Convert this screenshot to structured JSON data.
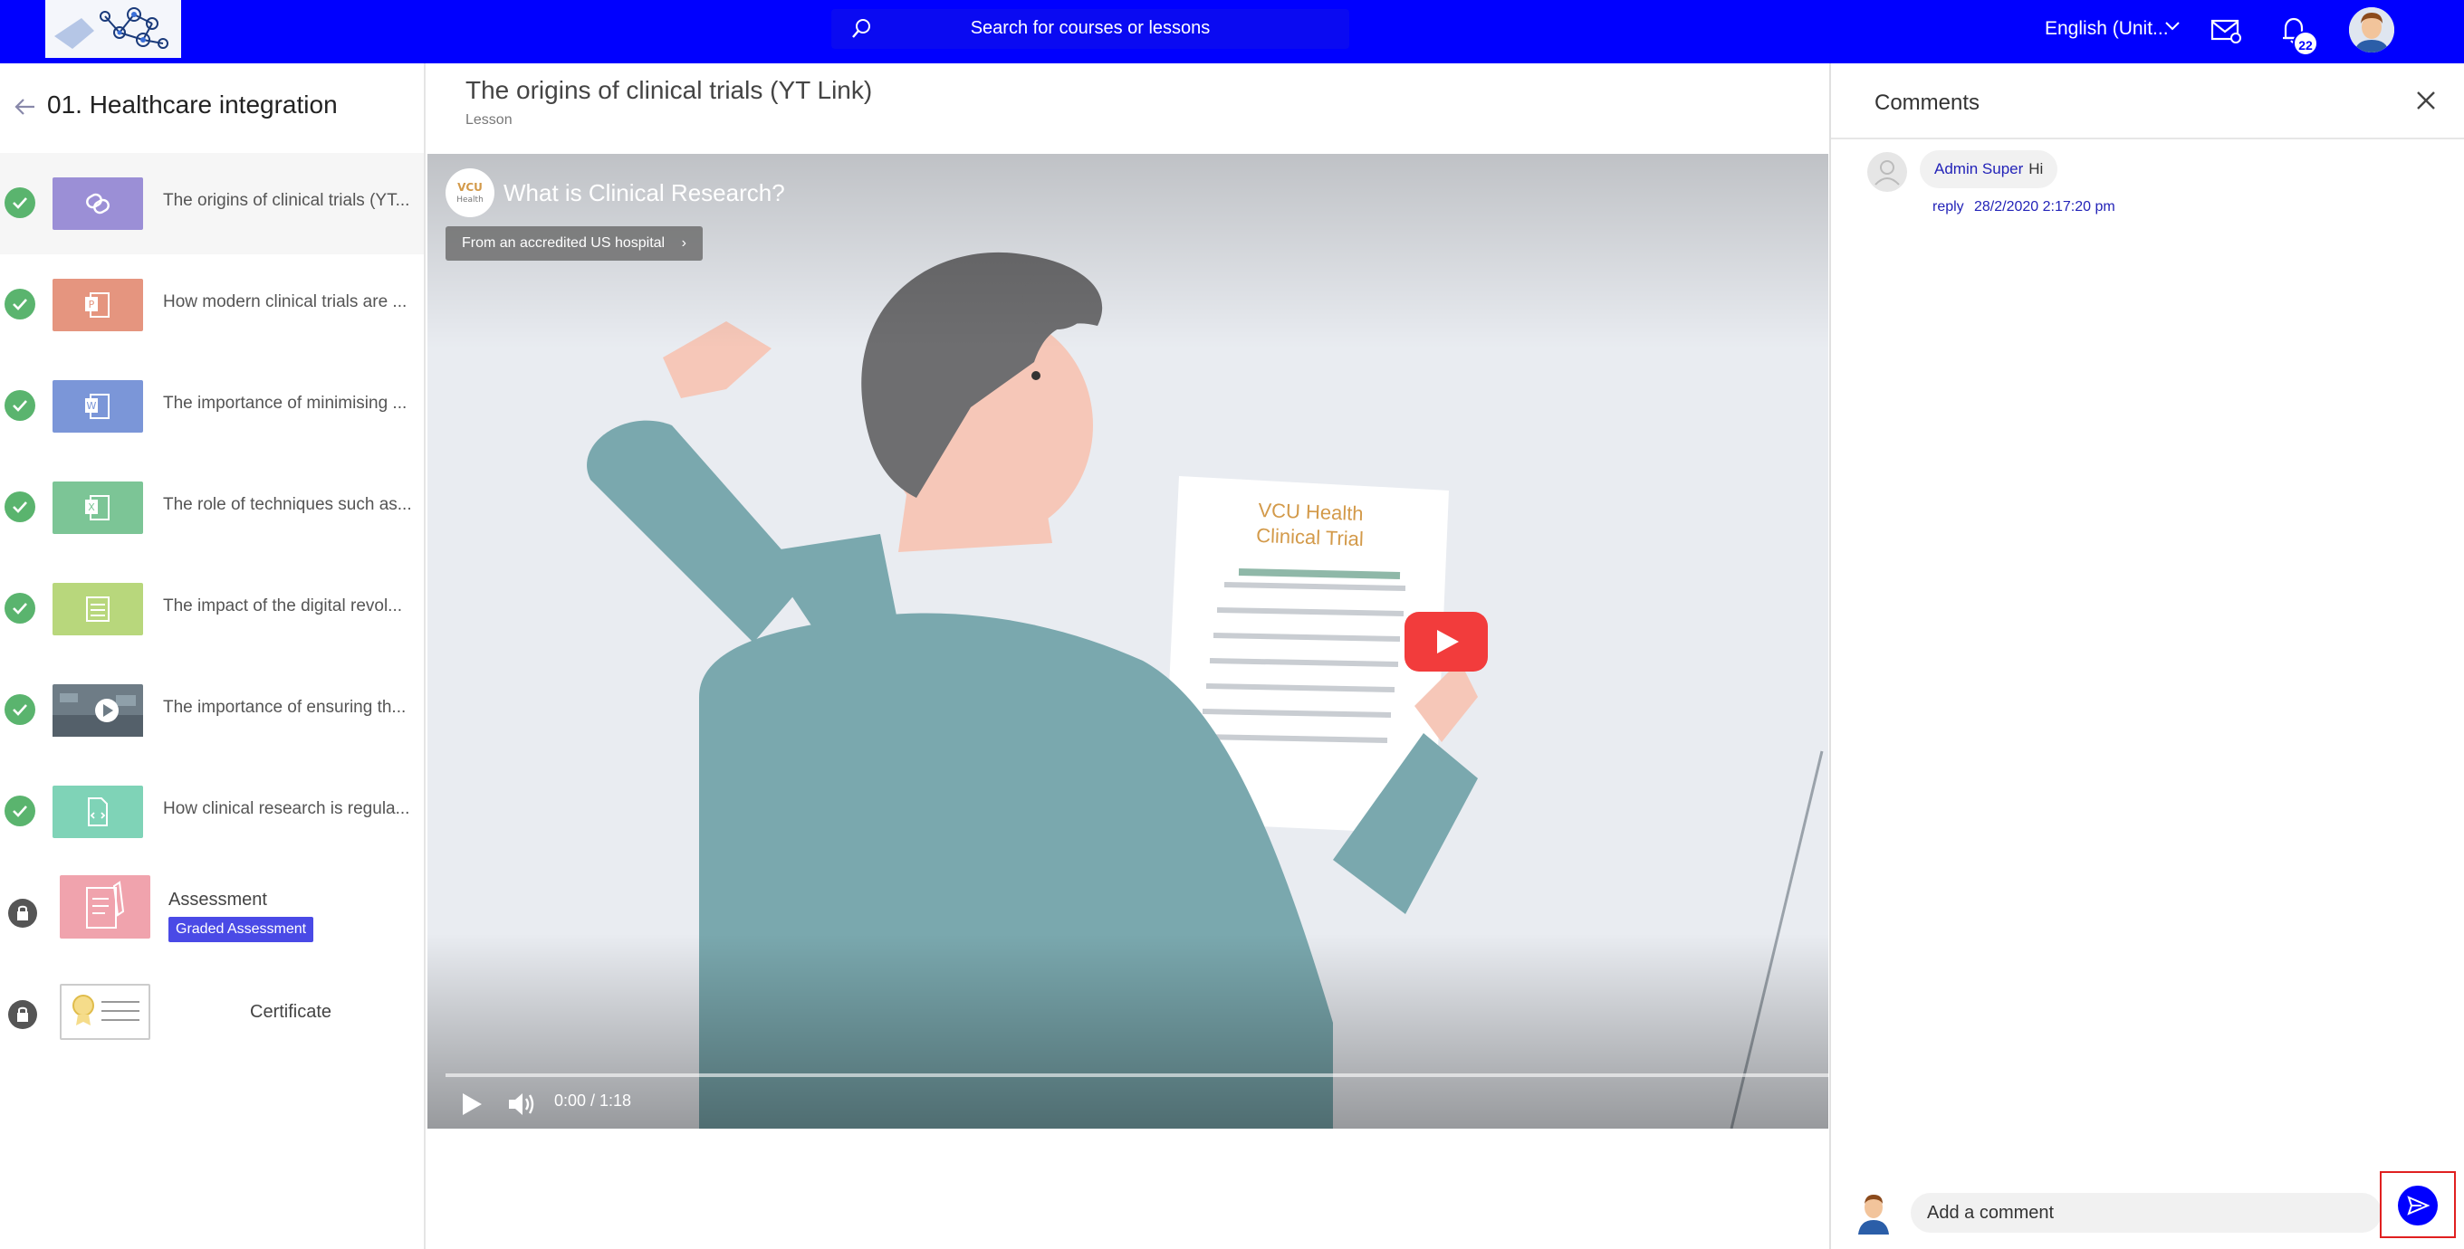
{
  "header": {
    "search_placeholder": "Search for courses or lessons",
    "language": "English (Unit...",
    "notification_count": "22",
    "brand_color": "#0000ff"
  },
  "sidebar": {
    "course_title": "01. Healthcare integration",
    "lessons": [
      {
        "label": "The origins of clinical trials (YT...",
        "icon": "link-icon",
        "color": "#9b8fd6",
        "status": "completed"
      },
      {
        "label": "How modern clinical trials are ...",
        "icon": "powerpoint-icon",
        "color": "#e5957f",
        "status": "completed"
      },
      {
        "label": "The importance of minimising ...",
        "icon": "word-icon",
        "color": "#7b96d8",
        "status": "completed"
      },
      {
        "label": "The role of techniques such as...",
        "icon": "excel-icon",
        "color": "#7cc596",
        "status": "completed"
      },
      {
        "label": "The impact of the digital revol...",
        "icon": "document-icon",
        "color": "#b8d77c",
        "status": "completed"
      },
      {
        "label": "The importance of ensuring th...",
        "icon": "video-thumbnail-icon",
        "color": "#6e7c86",
        "status": "completed"
      },
      {
        "label": "How clinical research is regula...",
        "icon": "html-file-icon",
        "color": "#7fd3b7",
        "status": "completed"
      }
    ],
    "assessment": {
      "title": "Assessment",
      "badge": "Graded Assessment",
      "status": "locked"
    },
    "certificate": {
      "title": "Certificate",
      "status": "locked"
    }
  },
  "main": {
    "lesson_title": "The origins of clinical trials (YT Link)",
    "lesson_type": "Lesson",
    "video": {
      "title": "What is Clinical Research?",
      "chip": "From an accredited US hospital",
      "document_line1": "VCU Health",
      "document_line2": "Clinical Trial",
      "time": "0:00 / 1:18",
      "progress": 0
    }
  },
  "comments": {
    "title": "Comments",
    "items": [
      {
        "author": "Admin Super",
        "text": "Hi",
        "reply_label": "reply",
        "timestamp": "28/2/2020 2:17:20 pm"
      }
    ],
    "input_placeholder": "Add a comment"
  }
}
